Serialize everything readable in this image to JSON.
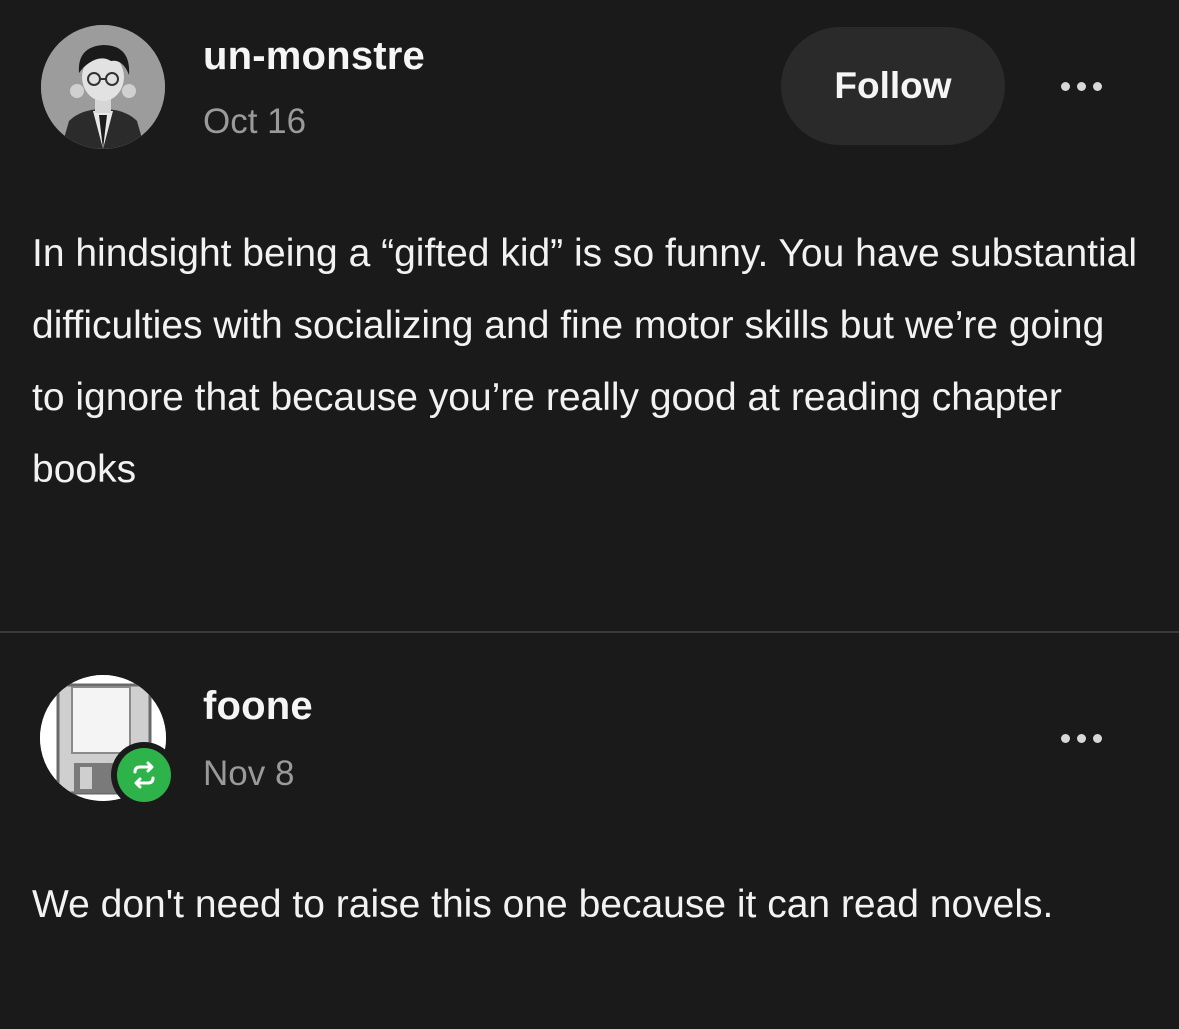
{
  "posts": [
    {
      "username": "un-monstre",
      "date": "Oct 16",
      "follow_label": "Follow",
      "avatar_icon": "person-illustration-avatar",
      "body": "In hindsight being a “gifted kid” is so funny. You have substantial difficulties with socializing and fine motor skills but we’re going to ignore that because you’re really good at reading chapter books"
    },
    {
      "username": "foone",
      "date": "Nov 8",
      "avatar_icon": "floppy-disk-avatar",
      "badge_icon": "reblog-icon",
      "badge_color": "#2db34a",
      "body": "We don't need to raise this one because it can read novels."
    }
  ],
  "theme": {
    "background": "#1a1a1a",
    "muted_text": "#9a9a9a",
    "follow_button_bg": "#2a2a2a"
  }
}
